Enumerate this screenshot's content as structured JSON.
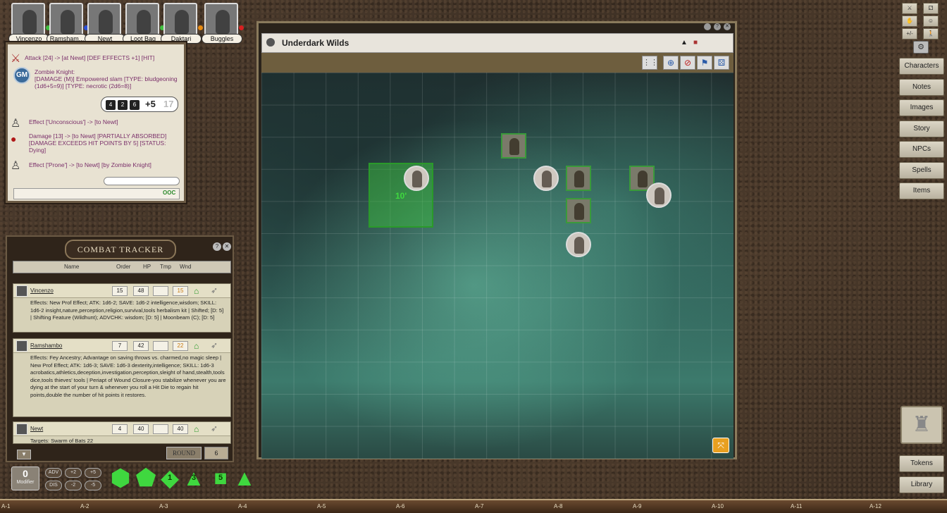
{
  "portraits": [
    {
      "name": "Vincenzo",
      "dot": "#3fbf3f"
    },
    {
      "name": "Ramsham...",
      "dot": "#2a4fd8"
    },
    {
      "name": "Newt",
      "dot": ""
    },
    {
      "name": "Loot Bag",
      "dot": "#3fbf3f"
    },
    {
      "name": "Daktari",
      "dot": "#e88a10"
    },
    {
      "name": "Buggles",
      "dot": "#d82020"
    }
  ],
  "chat": {
    "lines": [
      {
        "text": "Attack [24] -> [at Newt] [DEF EFFECTS +1] [HIT]",
        "icon": "sword-icon"
      },
      {
        "text": "Zombie Knight:",
        "icon": "gm-icon"
      },
      {
        "text": "[DAMAGE (M)] Empowered slam [TYPE: bludgeoning (1d6+5=9)] [TYPE: necrotic (2d6=8)]",
        "icon": ""
      },
      {
        "text": "Effect ['Unconscious'] -> [to Newt]",
        "icon": "figure-icon"
      },
      {
        "text": "Damage [13] -> [to Newt] [PARTIALLY ABSORBED] [DAMAGE EXCEEDS HIT POINTS BY 5] [STATUS: Dying]",
        "icon": "blood-drop-icon"
      },
      {
        "text": "Effect ['Prone'] -> [to Newt] [by Zombie Knight]",
        "icon": "figure-icon"
      }
    ],
    "gm_badge": "GM",
    "dice": [
      "4",
      "2",
      "6"
    ],
    "roll_total": "+5",
    "roll_result": "17",
    "ooc": "OOC"
  },
  "combat": {
    "title": "COMBAT TRACKER",
    "headers": {
      "name": "Name",
      "order": "Order",
      "hp": "HP",
      "tmp": "Tmp",
      "wnd": "Wnd"
    },
    "entries": [
      {
        "name": "Vincenzo",
        "order": "15",
        "hp": "48",
        "tmp": "",
        "wnd": "15",
        "effects": "Effects: New Prof Effect; ATK: 1d6-2; SAVE: 1d6-2 intelligence,wisdom; SKILL: 1d6-2 insight,nature,perception,religion,survival,tools herbalism kit | Shifted; [D: 5] | Shifting Feature (Wildhunt); ADVCHK: wisdom; [D: 5] | Moonbeam (C); [D: 5]"
      },
      {
        "name": "Ramshambo",
        "order": "7",
        "hp": "42",
        "tmp": "",
        "wnd": "22",
        "effects": "Effects: Fey Ancestry; Advantage on saving throws vs. charmed,no magic sleep | New Prof Effect; ATK: 1d6-3; SAVE: 1d6-3 dexterity,intelligence; SKILL: 1d6-3 acrobatics,athletics,deception,investigation,perception,sleight of hand,stealth,tools dice,tools thieves' tools | Periapt of Wound Closure-you stabilize whenever you are dying at the start of your turn & whenever you roll a Hit Die to regain hit points,double the number of hit points it restores."
      },
      {
        "name": "Newt",
        "order": "4",
        "hp": "40",
        "tmp": "",
        "wnd": "40",
        "effects": "Targets: Swarm of Bats 22"
      }
    ],
    "round_label": "ROUND",
    "round_value": "6"
  },
  "modifier": {
    "value": "0",
    "label": "Modifier"
  },
  "mod_buttons": [
    "ADV",
    "+2",
    "+5",
    "DIS",
    "-2",
    "-5"
  ],
  "dice_tray": [
    "d20",
    "d12",
    "d10",
    "d8",
    "d6",
    "d4"
  ],
  "dice_tray_faces": [
    "",
    "",
    "1",
    "3",
    "5",
    ""
  ],
  "map": {
    "title": "Underdark Wilds",
    "highlight_label": "10'"
  },
  "sidebar": {
    "top_tools": [
      "⚔",
      "⚁",
      "✋",
      "☺",
      "+/-",
      "🚶"
    ],
    "buttons": [
      "Characters",
      "Notes",
      "Images",
      "Story",
      "NPCs",
      "Spells",
      "Items"
    ],
    "bottom_buttons": [
      "Tokens",
      "Library"
    ]
  },
  "hotkeys": [
    "A-1",
    "A-2",
    "A-3",
    "A-4",
    "A-5",
    "A-6",
    "A-7",
    "A-8",
    "A-9",
    "A-10",
    "A-11",
    "A-12"
  ],
  "colors": {
    "accent_green": "#3fd83f",
    "chat_text": "#7a2f6a"
  }
}
